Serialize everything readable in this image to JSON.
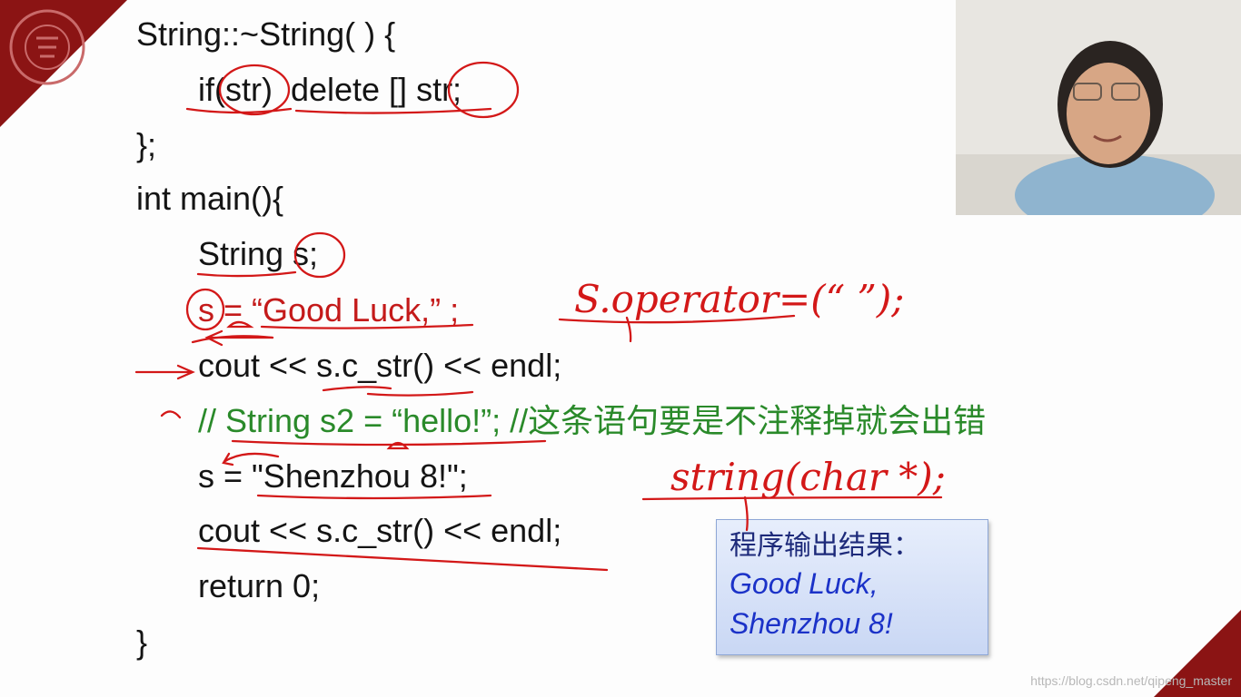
{
  "code_lines": [
    "String::~String( ) {",
    "if(str)  delete [] str;",
    "};",
    "int main(){",
    "String s;",
    "s = “Good Luck,” ;",
    "cout << s.c_str() << endl;",
    "// String s2 = “hello!”; //这条语句要是不注释掉就会出错",
    "s = \"Shenzhou 8!\";",
    "cout << s.c_str() << endl;",
    "return 0;",
    "}"
  ],
  "output_box": {
    "title": "程序输出结果：",
    "lines": [
      "Good Luck,",
      "Shenzhou 8!"
    ]
  },
  "handwriting": {
    "operator_note": "S.operator=(“    ”);",
    "string_note": "string(char *);"
  },
  "watermark": "https://blog.csdn.net/qipeng_master",
  "colors": {
    "corner": "#8b1414",
    "comment_green": "#2a8a2a",
    "annotation_red": "#d31818",
    "output_text": "#1b32c8"
  }
}
